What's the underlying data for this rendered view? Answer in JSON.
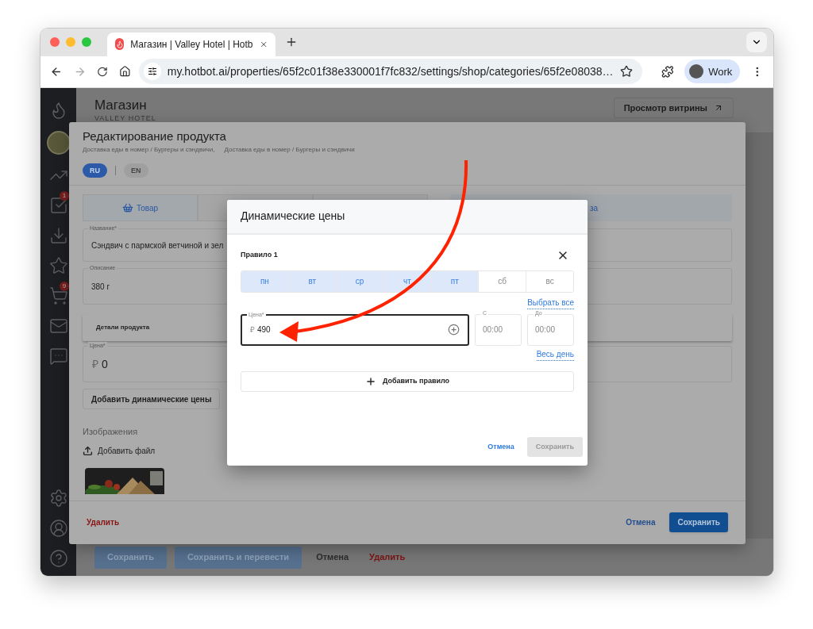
{
  "browser": {
    "tab": {
      "title": "Магазин | Valley Hotel | Hotb"
    },
    "url": "my.hotbot.ai/properties/65f2c01f38e330001f7fc832/settings/shop/categories/65f2e08038…",
    "profile": "Work"
  },
  "sidebar": {
    "tasks_badge": "1",
    "cart_badge": "9"
  },
  "page": {
    "title": "Магазин",
    "subtitle": "VALLEY HOTEL",
    "storefront_button": "Просмотр витрины",
    "footer_buttons": [
      {
        "label": "Сохранить",
        "kind": "primary"
      },
      {
        "label": "Сохранить и перевести",
        "kind": "primary"
      },
      {
        "label": "Отмена",
        "kind": "plain"
      },
      {
        "label": "Удалить",
        "kind": "danger"
      }
    ]
  },
  "product_modal": {
    "title": "Редактирование продукта",
    "breadcrumbs": [
      "Доставка еды в номер / Бургеры и сэндвичи,",
      "Доставка еды в номер / Бургеры и сэндвичи"
    ],
    "languages": [
      {
        "label": "RU",
        "selected": true
      },
      {
        "label": "EN",
        "selected": false
      }
    ],
    "tabs": [
      {
        "label": "Товар",
        "selected": true
      }
    ],
    "banner": "за",
    "name": {
      "label": "Название*",
      "value": "Сэндвич с пармской ветчиной и зел"
    },
    "description": {
      "label": "Описание",
      "value": "380 г"
    },
    "details_section": "Детали продукта",
    "price": {
      "label": "Цена*",
      "currency": "₽",
      "value": "0"
    },
    "dynamic_price_button": "Добавить динамические цены",
    "images": {
      "label": "Изображения",
      "upload": "Добавить файл"
    },
    "footer": {
      "delete": "Удалить",
      "cancel": "Отмена",
      "save": "Сохранить"
    }
  },
  "dialog": {
    "title": "Динамические цены",
    "rule": {
      "title": "Правило 1",
      "days": [
        {
          "label": "пн",
          "selected": true
        },
        {
          "label": "вт",
          "selected": true
        },
        {
          "label": "ср",
          "selected": true
        },
        {
          "label": "чт",
          "selected": true
        },
        {
          "label": "пт",
          "selected": true
        },
        {
          "label": "сб",
          "selected": false
        },
        {
          "label": "вс",
          "selected": false
        }
      ],
      "select_all": "Выбрать все",
      "price": {
        "label": "Цена*",
        "currency": "₽",
        "value": "490"
      },
      "from": {
        "label": "С",
        "placeholder": "00:00"
      },
      "to": {
        "label": "До",
        "placeholder": "00:00"
      },
      "all_day": "Весь день"
    },
    "add_rule": "Добавить правило",
    "cancel": "Отмена",
    "save": {
      "label": "Сохранить",
      "disabled": true
    }
  }
}
